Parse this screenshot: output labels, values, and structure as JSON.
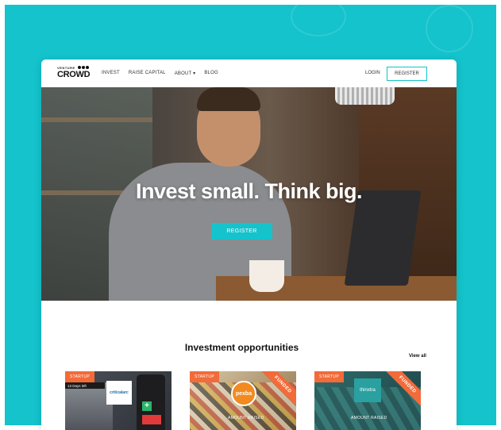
{
  "colors": {
    "accent": "#14c3cc",
    "badge": "#f26b3a",
    "text": "#111111"
  },
  "nav": {
    "logo_small": "VENTURE",
    "logo_big": "CROWD",
    "links": [
      "INVEST",
      "RAISE CAPITAL",
      "ABOUT ▾",
      "BLOG"
    ],
    "login": "LOGIN",
    "register": "REGISTER"
  },
  "hero": {
    "title": "Invest small. Think big.",
    "button": "REGISTER"
  },
  "section": {
    "title": "Investment opportunities",
    "view_all": "View all"
  },
  "cards": [
    {
      "badge": "STARTUP",
      "days": "13 Days left",
      "logo": "criticalarc",
      "ribbon": ""
    },
    {
      "badge": "STARTUP",
      "logo": "pexba",
      "ribbon": "FUNDED",
      "amount": "AMOUNT RAISED"
    },
    {
      "badge": "STARTUP",
      "logo": "thinxtra",
      "ribbon": "FUNDED",
      "amount": "AMOUNT RAISED"
    }
  ]
}
